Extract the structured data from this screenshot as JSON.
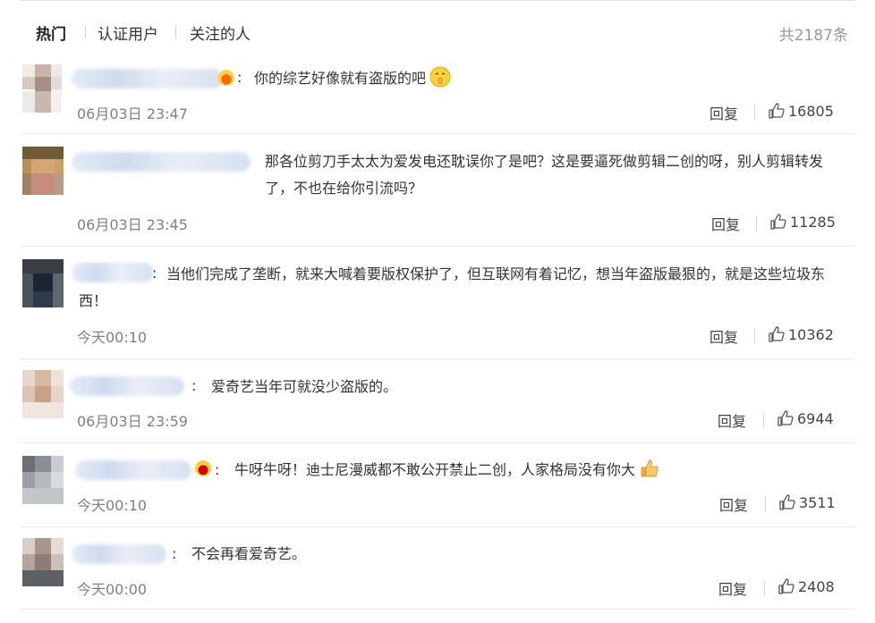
{
  "tabs": [
    {
      "label": "热门",
      "active": true
    },
    {
      "label": "认证用户",
      "active": false
    },
    {
      "label": "关注的人",
      "active": false
    }
  ],
  "total": "共2187条",
  "reply_label": "回复",
  "comments": [
    {
      "text": "你的综艺好像就有盗版的吧",
      "emoji": "shushing-face",
      "time": "06月03日 23:47",
      "likes": "16805",
      "badge": "fire-badge"
    },
    {
      "text": "那各位剪刀手太太为爱发电还耽误你了是吧？这是要逼死做剪辑二创的呀，别人剪辑转发了，不也在给你引流吗？",
      "emoji": "",
      "time": "06月03日 23:45",
      "likes": "11285",
      "badge": ""
    },
    {
      "text": "当他们完成了垄断，就来大喊着要版权保护了，但互联网有着记忆，想当年盗版最狠的，就是这些垃圾东西！",
      "emoji": "",
      "time": "今天00:10",
      "likes": "10362",
      "badge": ""
    },
    {
      "text": "爱奇艺当年可就没少盗版的。",
      "emoji": "",
      "time": "06月03日 23:59",
      "likes": "6944",
      "badge": ""
    },
    {
      "text": "牛呀牛呀！迪士尼漫威都不敢公开禁止二创，人家格局没有你大",
      "emoji": "thumbs-up",
      "time": "今天00:10",
      "likes": "3511",
      "badge": "crown-badge"
    },
    {
      "text": "不会再看爱奇艺。",
      "emoji": "",
      "time": "今天00:00",
      "likes": "2408",
      "badge": ""
    }
  ]
}
